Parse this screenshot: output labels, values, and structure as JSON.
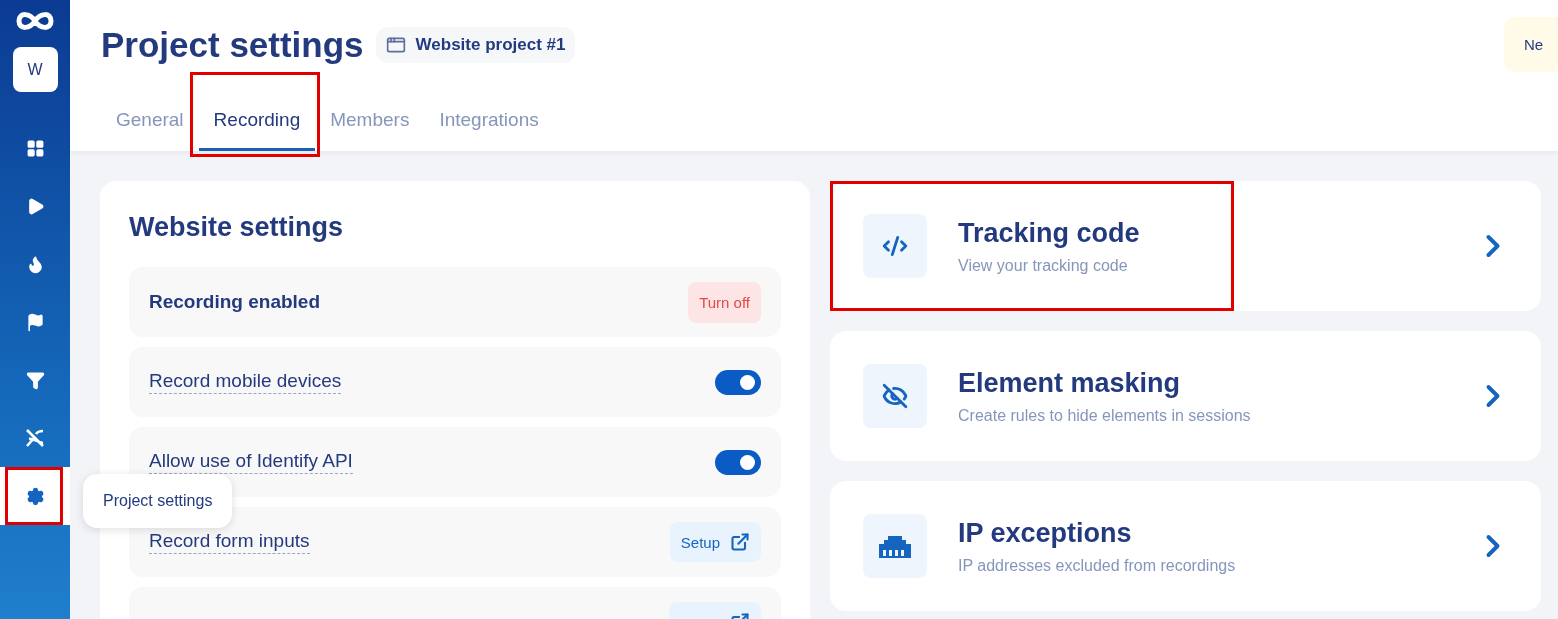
{
  "sidebar": {
    "avatar": "W",
    "items": [
      {
        "selected": false,
        "highlighted": false
      },
      {
        "selected": false,
        "highlighted": false
      },
      {
        "selected": false,
        "highlighted": false
      },
      {
        "selected": false,
        "highlighted": false
      },
      {
        "selected": false,
        "highlighted": false
      },
      {
        "selected": false,
        "highlighted": false
      },
      {
        "selected": true,
        "highlighted": true,
        "tooltip": "Project settings"
      }
    ]
  },
  "header": {
    "title": "Project settings",
    "project": "Website project #1",
    "notice": "Ne"
  },
  "tabs": [
    {
      "label": "General",
      "selected": false,
      "highlighted": false
    },
    {
      "label": "Recording",
      "selected": true,
      "highlighted": true
    },
    {
      "label": "Members",
      "selected": false,
      "highlighted": false
    },
    {
      "label": "Integrations",
      "selected": false,
      "highlighted": false
    }
  ],
  "website_settings": {
    "title": "Website settings",
    "rows": [
      {
        "kind": "status",
        "label": "Recording enabled",
        "action": "Turn off"
      },
      {
        "kind": "toggle",
        "label": "Record mobile devices",
        "on": true
      },
      {
        "kind": "toggle",
        "label": "Allow use of Identify API",
        "on": true
      },
      {
        "kind": "link",
        "label": "Record form inputs",
        "action": "Setup"
      },
      {
        "kind": "link"
      }
    ]
  },
  "cards": [
    {
      "title": "Tracking code",
      "subtitle": "View your tracking code",
      "highlighted": true
    },
    {
      "title": "Element masking",
      "subtitle": "Create rules to hide elements in sessions",
      "highlighted": false
    },
    {
      "title": "IP exceptions",
      "subtitle": "IP addresses excluded from recordings",
      "highlighted": false
    }
  ]
}
